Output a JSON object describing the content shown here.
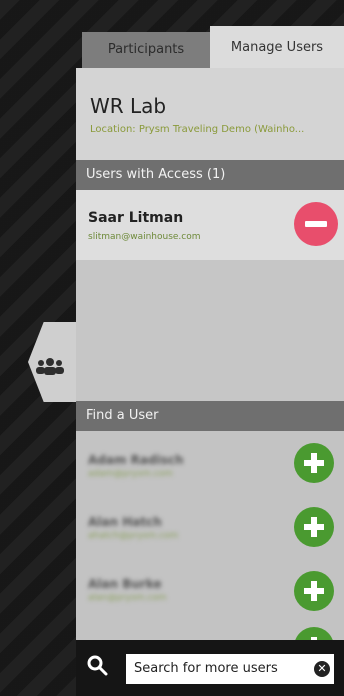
{
  "tabs": [
    {
      "label": "Participants"
    },
    {
      "label": "Manage Users"
    }
  ],
  "lab": {
    "title": "WR Lab",
    "location": "Location: Prysm Traveling Demo (Wainho..."
  },
  "access_section": {
    "label": "Users with Access (1)",
    "users": [
      {
        "name": "Saar Litman",
        "email": "slitman@wainhouse.com"
      }
    ]
  },
  "find_section": {
    "label": "Find a User",
    "users": [
      {
        "name": "Adam Radisch",
        "email": "adam@prysm.com"
      },
      {
        "name": "Alan Hatch",
        "email": "ahatch@prysm.com"
      },
      {
        "name": "Alan Burke",
        "email": "alan@prysm.com"
      }
    ]
  },
  "search": {
    "placeholder": "Search for more users"
  },
  "icons": {
    "side_handle": "users-icon",
    "remove": "minus-icon",
    "add": "plus-icon",
    "search": "search-icon",
    "clear": "close-icon"
  },
  "colors": {
    "remove": "#e84e6c",
    "add": "#4a9a30",
    "location_text": "#8a9a3a"
  }
}
